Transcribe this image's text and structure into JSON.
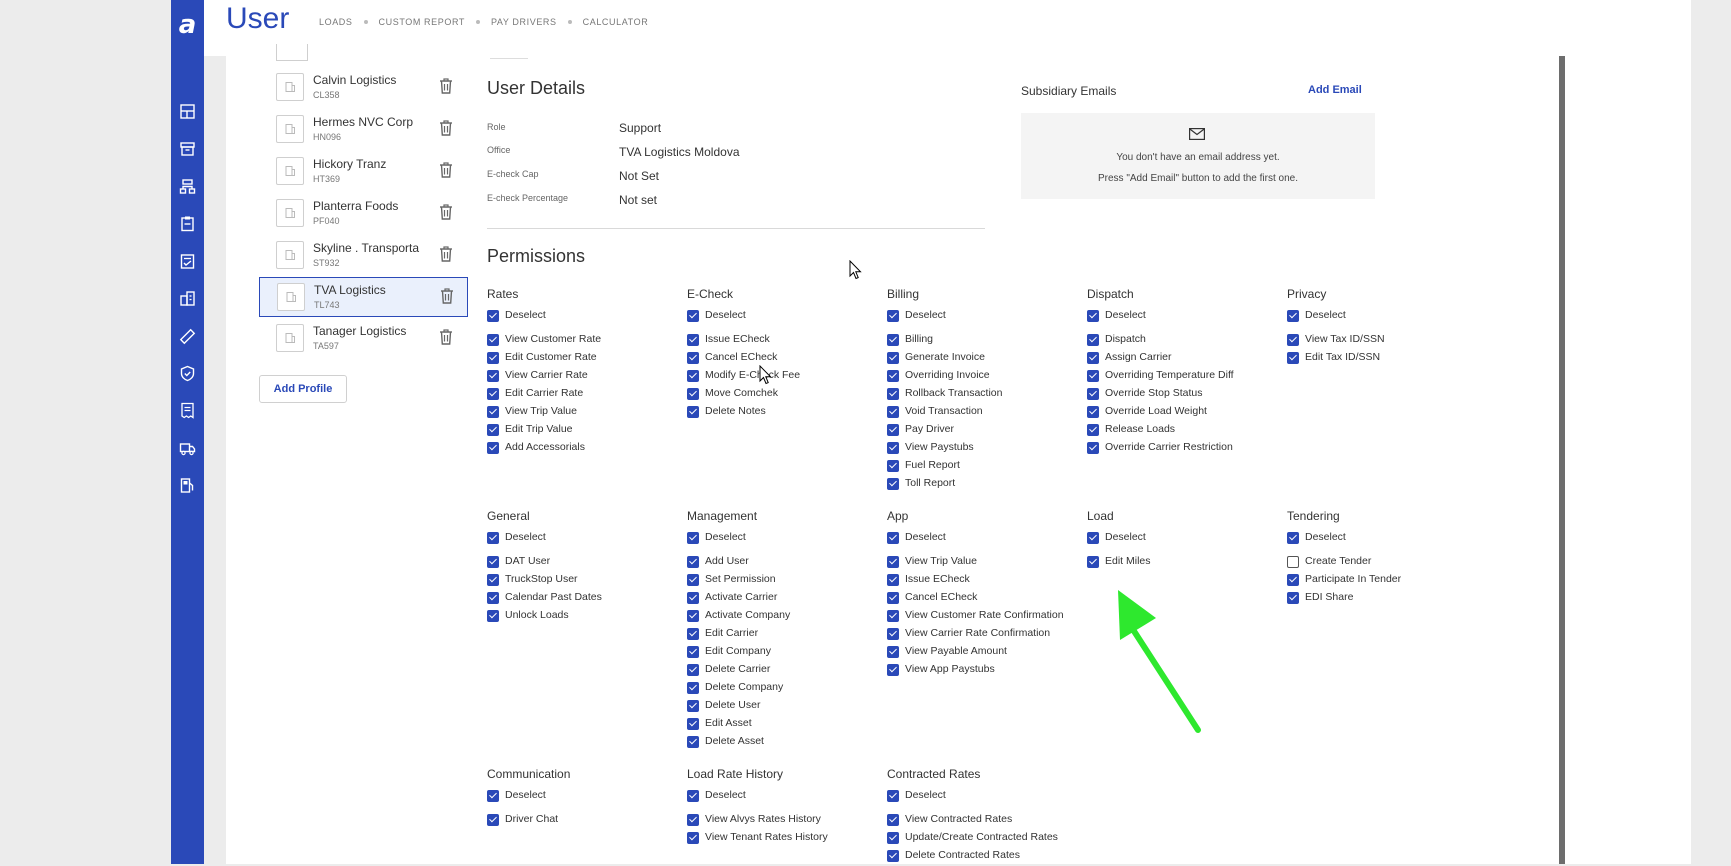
{
  "app": {
    "logo": "a",
    "title": "User",
    "top_nav": [
      "LOADS",
      "CUSTOM REPORT",
      "PAY DRIVERS",
      "CALCULATOR"
    ],
    "accent_color": "#2a49b8"
  },
  "sidebar": {
    "icons": [
      "dashboard-icon",
      "archive-icon",
      "network-icon",
      "clipboard-icon",
      "checklist-icon",
      "building-icon",
      "ruler-icon",
      "shield-icon",
      "receipt-icon",
      "truck-icon",
      "fuel-icon"
    ]
  },
  "profiles": [
    {
      "name": "Calvin Logistics",
      "code": "CL358",
      "selected": false
    },
    {
      "name": "Hermes NVC Corp",
      "code": "HN096",
      "selected": false
    },
    {
      "name": "Hickory Tranz",
      "code": "HT369",
      "selected": false
    },
    {
      "name": "Planterra Foods",
      "code": "PF040",
      "selected": false
    },
    {
      "name": "Skyline . Transporta",
      "code": "ST932",
      "selected": false
    },
    {
      "name": "TVA Logistics",
      "code": "TL743",
      "selected": true
    },
    {
      "name": "Tanager Logistics",
      "code": "TA597",
      "selected": false
    }
  ],
  "add_profile_label": "Add Profile",
  "user_details": {
    "title": "User Details",
    "fields": [
      {
        "label": "Role",
        "value": "Support"
      },
      {
        "label": "Office",
        "value": "TVA Logistics Moldova"
      },
      {
        "label": "E-check Cap",
        "value": "Not Set"
      },
      {
        "label": "E-check Percentage",
        "value": "Not set"
      }
    ]
  },
  "subsidiary": {
    "title": "Subsidiary Emails",
    "add_label": "Add Email",
    "empty_line1": "You don't have an email address yet.",
    "empty_line2": "Press \"Add Email\" button to add the first one."
  },
  "permissions": {
    "title": "Permissions",
    "groups": [
      {
        "title": "Rates",
        "deselect": "Deselect",
        "items": [
          {
            "label": "View Customer Rate",
            "checked": true
          },
          {
            "label": "Edit Customer Rate",
            "checked": true
          },
          {
            "label": "View Carrier Rate",
            "checked": true
          },
          {
            "label": "Edit Carrier Rate",
            "checked": true
          },
          {
            "label": "View Trip Value",
            "checked": true
          },
          {
            "label": "Edit Trip Value",
            "checked": true
          },
          {
            "label": "Add Accessorials",
            "checked": true
          }
        ]
      },
      {
        "title": "E-Check",
        "deselect": "Deselect",
        "items": [
          {
            "label": "Issue ECheck",
            "checked": true
          },
          {
            "label": "Cancel ECheck",
            "checked": true
          },
          {
            "label": "Modify E-Check Fee",
            "checked": true
          },
          {
            "label": "Move Comchek",
            "checked": true
          },
          {
            "label": "Delete Notes",
            "checked": true
          }
        ]
      },
      {
        "title": "Billing",
        "deselect": "Deselect",
        "items": [
          {
            "label": "Billing",
            "checked": true
          },
          {
            "label": "Generate Invoice",
            "checked": true
          },
          {
            "label": "Overriding Invoice",
            "checked": true
          },
          {
            "label": "Rollback Transaction",
            "checked": true
          },
          {
            "label": "Void Transaction",
            "checked": true
          },
          {
            "label": "Pay Driver",
            "checked": true
          },
          {
            "label": "View Paystubs",
            "checked": true
          },
          {
            "label": "Fuel Report",
            "checked": true
          },
          {
            "label": "Toll Report",
            "checked": true
          }
        ]
      },
      {
        "title": "Dispatch",
        "deselect": "Deselect",
        "items": [
          {
            "label": "Dispatch",
            "checked": true
          },
          {
            "label": "Assign Carrier",
            "checked": true
          },
          {
            "label": "Overriding Temperature Diff",
            "checked": true
          },
          {
            "label": "Override Stop Status",
            "checked": true
          },
          {
            "label": "Override Load Weight",
            "checked": true
          },
          {
            "label": "Release Loads",
            "checked": true
          },
          {
            "label": "Override Carrier Restriction",
            "checked": true
          }
        ]
      },
      {
        "title": "Privacy",
        "deselect": "Deselect",
        "items": [
          {
            "label": "View Tax ID/SSN",
            "checked": true
          },
          {
            "label": "Edit Tax ID/SSN",
            "checked": true
          }
        ]
      },
      {
        "title": "General",
        "deselect": "Deselect",
        "items": [
          {
            "label": "DAT User",
            "checked": true
          },
          {
            "label": "TruckStop User",
            "checked": true
          },
          {
            "label": "Calendar Past Dates",
            "checked": true
          },
          {
            "label": "Unlock Loads",
            "checked": true
          }
        ]
      },
      {
        "title": "Management",
        "deselect": "Deselect",
        "items": [
          {
            "label": "Add User",
            "checked": true
          },
          {
            "label": "Set Permission",
            "checked": true
          },
          {
            "label": "Activate Carrier",
            "checked": true
          },
          {
            "label": "Activate Company",
            "checked": true
          },
          {
            "label": "Edit Carrier",
            "checked": true
          },
          {
            "label": "Edit Company",
            "checked": true
          },
          {
            "label": "Delete Carrier",
            "checked": true
          },
          {
            "label": "Delete Company",
            "checked": true
          },
          {
            "label": "Delete User",
            "checked": true
          },
          {
            "label": "Edit Asset",
            "checked": true
          },
          {
            "label": "Delete Asset",
            "checked": true
          }
        ]
      },
      {
        "title": "App",
        "deselect": "Deselect",
        "items": [
          {
            "label": "View Trip Value",
            "checked": true
          },
          {
            "label": "Issue ECheck",
            "checked": true
          },
          {
            "label": "Cancel ECheck",
            "checked": true
          },
          {
            "label": "View Customer Rate Confirmation",
            "checked": true
          },
          {
            "label": "View Carrier Rate Confirmation",
            "checked": true
          },
          {
            "label": "View Payable Amount",
            "checked": true
          },
          {
            "label": "View App Paystubs",
            "checked": true
          }
        ]
      },
      {
        "title": "Load",
        "deselect": "Deselect",
        "items": [
          {
            "label": "Edit Miles",
            "checked": true
          }
        ]
      },
      {
        "title": "Tendering",
        "deselect": "Deselect",
        "items": [
          {
            "label": "Create Tender",
            "checked": false
          },
          {
            "label": "Participate In Tender",
            "checked": true
          },
          {
            "label": "EDI Share",
            "checked": true
          }
        ]
      },
      {
        "title": "Communication",
        "deselect": "Deselect",
        "items": [
          {
            "label": "Driver Chat",
            "checked": true
          }
        ]
      },
      {
        "title": "Load Rate History",
        "deselect": "Deselect",
        "items": [
          {
            "label": "View Alvys Rates History",
            "checked": true
          },
          {
            "label": "View Tenant Rates History",
            "checked": true
          }
        ]
      },
      {
        "title": "Contracted Rates",
        "deselect": "Deselect",
        "items": [
          {
            "label": "View Contracted Rates",
            "checked": true
          },
          {
            "label": "Update/Create Contracted Rates",
            "checked": true
          },
          {
            "label": "Delete Contracted Rates",
            "checked": true
          }
        ]
      }
    ]
  }
}
